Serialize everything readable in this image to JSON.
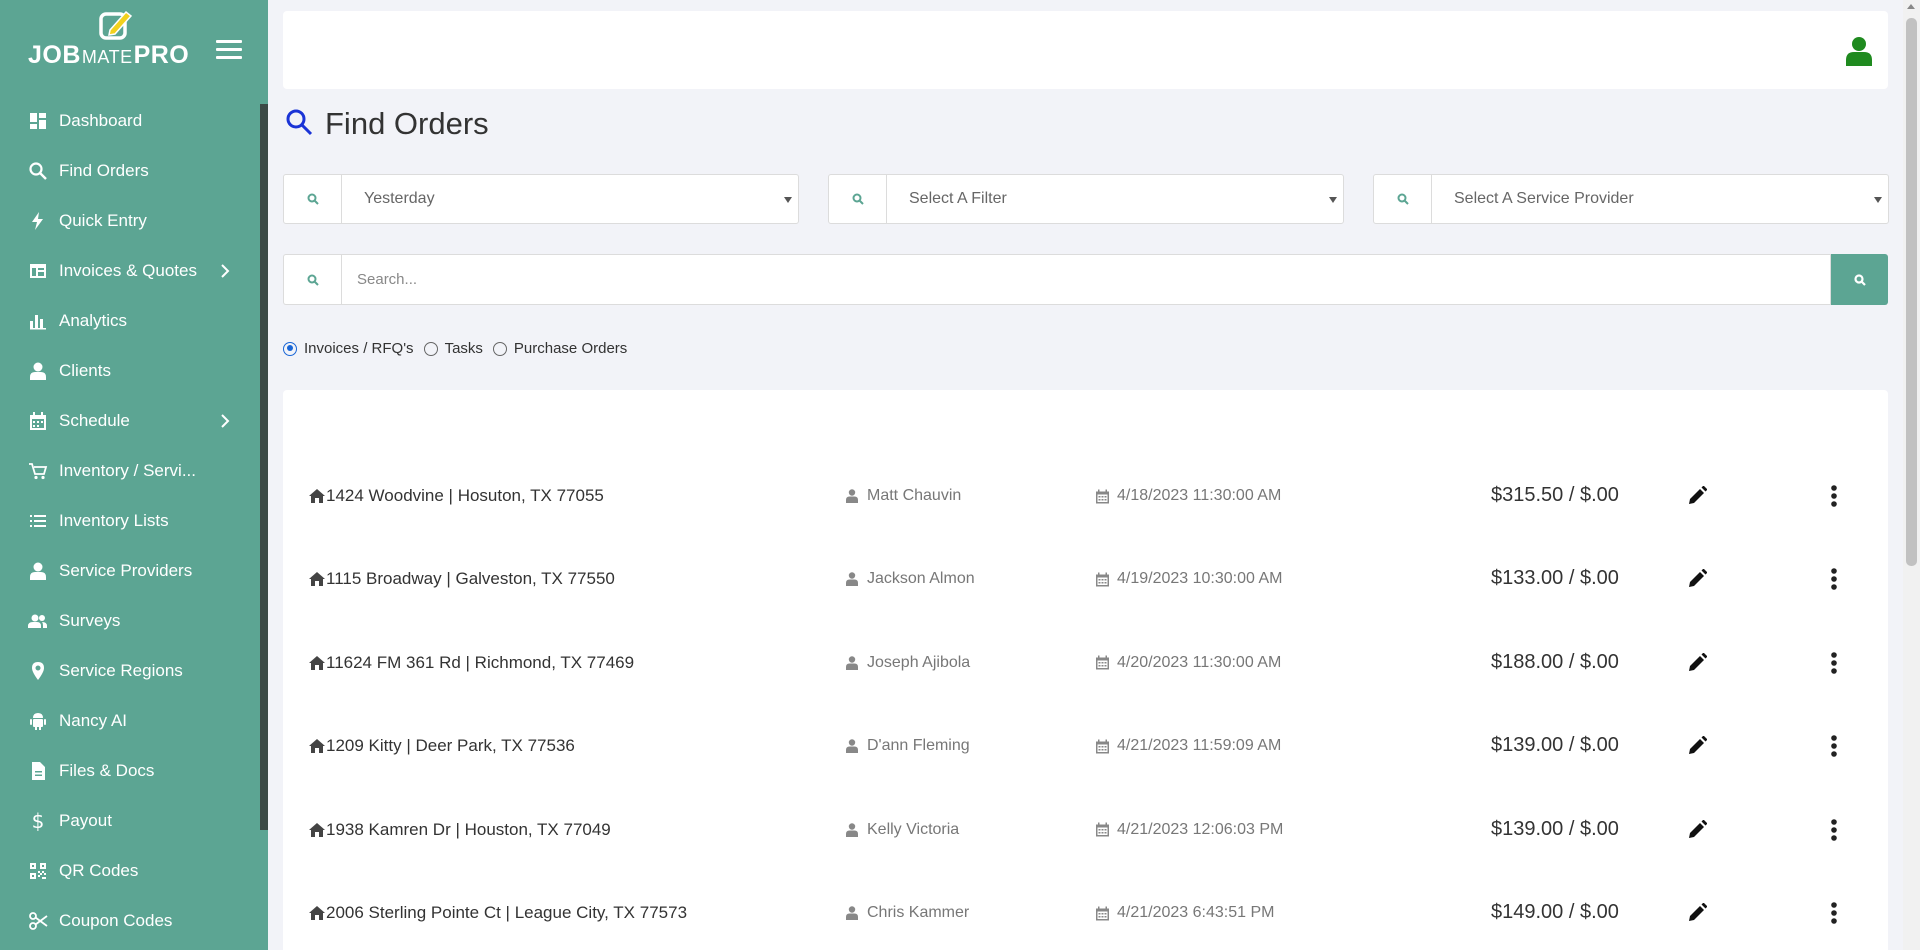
{
  "app": {
    "brand_part1": "JOB",
    "brand_part2": "MATE",
    "brand_part3": "PRO"
  },
  "sidebar": {
    "items": [
      {
        "label": "Dashboard",
        "icon": "dashboard-icon"
      },
      {
        "label": "Find Orders",
        "icon": "search-icon"
      },
      {
        "label": "Quick Entry",
        "icon": "bolt-icon"
      },
      {
        "label": "Invoices & Quotes",
        "icon": "invoice-icon",
        "expandable": true
      },
      {
        "label": "Analytics",
        "icon": "bar-chart-icon"
      },
      {
        "label": "Clients",
        "icon": "user-icon"
      },
      {
        "label": "Schedule",
        "icon": "calendar-icon",
        "expandable": true
      },
      {
        "label": "Inventory / Servi...",
        "icon": "cart-icon"
      },
      {
        "label": "Inventory Lists",
        "icon": "list-icon"
      },
      {
        "label": "Service Providers",
        "icon": "user-icon"
      },
      {
        "label": "Surveys",
        "icon": "people-icon"
      },
      {
        "label": "Service Regions",
        "icon": "map-pin-icon"
      },
      {
        "label": "Nancy AI",
        "icon": "android-icon"
      },
      {
        "label": "Files & Docs",
        "icon": "file-icon"
      },
      {
        "label": "Payout",
        "icon": "dollar-icon"
      },
      {
        "label": "QR Codes",
        "icon": "qr-code-icon"
      },
      {
        "label": "Coupon Codes",
        "icon": "scissors-icon"
      }
    ]
  },
  "page": {
    "title": "Find Orders"
  },
  "filters": {
    "date_range": "Yesterday",
    "filter": "Select A Filter",
    "service_provider": "Select A Service Provider"
  },
  "search": {
    "placeholder": "Search..."
  },
  "radios": [
    {
      "label": "Invoices / RFQ's",
      "checked": true
    },
    {
      "label": "Tasks",
      "checked": false
    },
    {
      "label": "Purchase Orders",
      "checked": false
    }
  ],
  "orders": [
    {
      "address": "1424 Woodvine | Hosuton, TX 77055",
      "client": "Matt Chauvin",
      "date": "4/18/2023 11:30:00 AM",
      "amount": "$315.50 / $.00"
    },
    {
      "address": "1115 Broadway | Galveston, TX 77550",
      "client": "Jackson Almon",
      "date": "4/19/2023 10:30:00 AM",
      "amount": "$133.00 / $.00"
    },
    {
      "address": "11624 FM 361 Rd | Richmond, TX 77469",
      "client": "Joseph Ajibola",
      "date": "4/20/2023 11:30:00 AM",
      "amount": "$188.00 / $.00"
    },
    {
      "address": "1209 Kitty | Deer Park, TX 77536",
      "client": "D'ann Fleming",
      "date": "4/21/2023 11:59:09 AM",
      "amount": "$139.00 / $.00"
    },
    {
      "address": "1938 Kamren Dr | Houston, TX 77049",
      "client": "Kelly Victoria",
      "date": "4/21/2023 12:06:03 PM",
      "amount": "$139.00 / $.00"
    },
    {
      "address": "2006 Sterling Pointe Ct | League City, TX 77573",
      "client": "Chris Kammer",
      "date": "4/21/2023 6:43:51 PM",
      "amount": "$149.00 / $.00"
    }
  ],
  "colors": {
    "sidebar_bg": "#5ca593",
    "accent_blue": "#1a33d6",
    "user_green": "#1f8a1f"
  }
}
